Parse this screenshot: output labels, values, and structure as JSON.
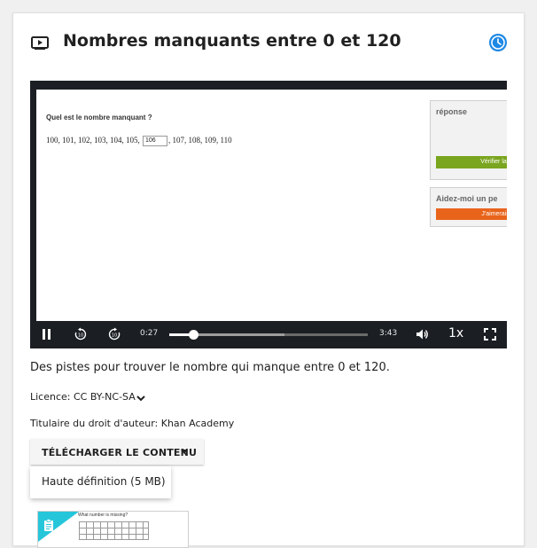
{
  "header": {
    "title": "Nombres manquants entre 0 et 120",
    "icon": "video-player-icon",
    "status_icon": "clock-icon",
    "accent_color": "#1e88e5"
  },
  "video": {
    "question": "Quel est le nombre manquant ?",
    "sequence_before": "100, 101, 102, 103, 104, 105,",
    "answer_value": "106",
    "sequence_after": ", 107, 108, 109, 110",
    "answer_panel_title": "réponse",
    "check_button": "Vérifier la",
    "help_panel_title": "Aidez-moi un pe",
    "hint_button": "J'aimerais u",
    "controls": {
      "current_time": "0:27",
      "duration": "3:43",
      "playback_rate": "1x",
      "progress_fraction": 0.12,
      "buffered_fraction": 0.58
    }
  },
  "description": "Des pistes pour trouver le nombre qui manque entre 0 et 120.",
  "license": "Licence: CC BY-NC-SA",
  "copyright_holder": "Titulaire du droit d'auteur: Khan Academy",
  "download": {
    "button_label": "TÉLÉCHARGER LE CONTENU",
    "options": [
      "Haute définition (5 MB)"
    ]
  },
  "related": {
    "thumbnail_title": "What number is missing?"
  }
}
